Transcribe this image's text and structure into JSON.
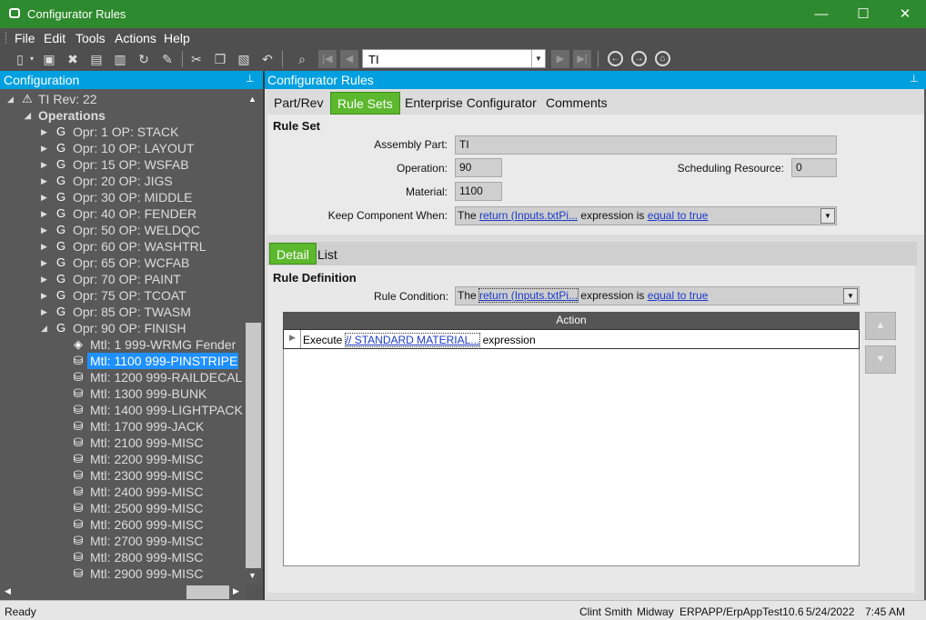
{
  "window": {
    "title": "Configurator Rules",
    "minimize": "—",
    "maximize": "☐",
    "close": "✕"
  },
  "menu": [
    "File",
    "Edit",
    "Tools",
    "Actions",
    "Help"
  ],
  "toolbar": {
    "search_value": "TI"
  },
  "left_panel": {
    "title": "Configuration",
    "pin": "⊥",
    "root": "TI Rev: 22",
    "operations_label": "Operations",
    "ops": [
      "Opr: 1 OP: STACK",
      "Opr: 10 OP: LAYOUT",
      "Opr: 15 OP: WSFAB",
      "Opr: 20 OP: JIGS",
      "Opr: 30 OP: MIDDLE",
      "Opr: 40 OP: FENDER",
      "Opr: 50 OP: WELDQC",
      "Opr: 60 OP: WASHTRL",
      "Opr: 65 OP: WCFAB",
      "Opr: 70 OP: PAINT",
      "Opr: 75 OP: TCOAT",
      "Opr: 85 OP: TWASM",
      "Opr: 90 OP: FINISH"
    ],
    "materials": [
      "Mtl: 1 999-WRMG Fender",
      "Mtl: 1100 999-PINSTRIPE",
      "Mtl: 1200 999-RAILDECAL",
      "Mtl: 1300 999-BUNK",
      "Mtl: 1400 999-LIGHTPACK",
      "Mtl: 1700 999-JACK",
      "Mtl: 2100 999-MISC",
      "Mtl: 2200 999-MISC",
      "Mtl: 2300 999-MISC",
      "Mtl: 2400 999-MISC",
      "Mtl: 2500 999-MISC",
      "Mtl: 2600 999-MISC",
      "Mtl: 2700 999-MISC",
      "Mtl: 2800 999-MISC",
      "Mtl: 2900 999-MISC"
    ],
    "selected_material_index": 1
  },
  "right_panel": {
    "title": "Configurator Rules",
    "tabs": [
      "Part/Rev",
      "Rule Sets",
      "Enterprise Configurator",
      "Comments"
    ],
    "active_tab": "Rule Sets",
    "section_title": "Rule Set",
    "assembly_part_label": "Assembly Part:",
    "assembly_part": "TI",
    "operation_label": "Operation:",
    "operation": "90",
    "scheduling_resource_label": "Scheduling Resource:",
    "scheduling_resource": "0",
    "material_label": "Material:",
    "material": "1100",
    "keep_label": "Keep Component When:",
    "keep": {
      "pre": "The ",
      "link1": "return (Inputs.txtPi...",
      "mid": " expression is ",
      "link2": "equal to true"
    },
    "subtabs": [
      "Detail",
      "List"
    ],
    "active_subtab": "Detail",
    "rule_def_title": "Rule Definition",
    "rule_condition_label": "Rule Condition:",
    "rule_condition": {
      "pre": "The ",
      "link1": "return (Inputs.txtPi...",
      "mid": " expression is ",
      "link2": "equal to true"
    },
    "grid_header": "Action",
    "grid_row": {
      "pre": "Execute ",
      "link": "// STANDARD MATERIAL...",
      "post": " expression"
    }
  },
  "status": {
    "text": "Ready",
    "user": "Clint Smith",
    "site": "Midway",
    "server": "ERPAPP/ErpAppTest10.6",
    "date": "5/24/2022",
    "time": "7:45 AM"
  }
}
